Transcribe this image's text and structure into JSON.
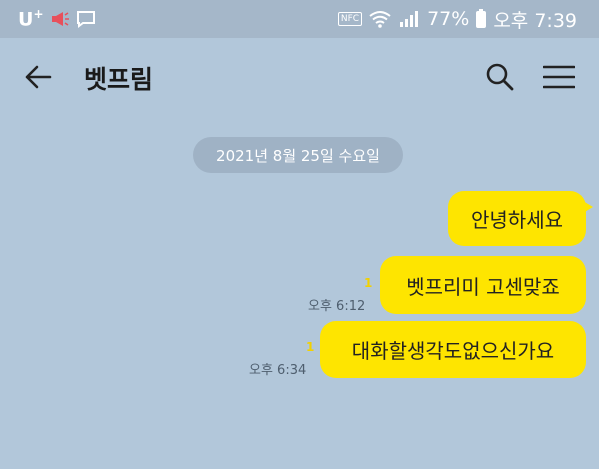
{
  "status_bar": {
    "carrier": "U",
    "carrier_sup": "+",
    "nfc_label": "NFC",
    "battery": "77%",
    "time": "오후 7:39"
  },
  "header": {
    "title": "벳프림",
    "back_icon": "arrow-left-icon",
    "search_icon": "search-icon",
    "menu_icon": "hamburger-menu-icon"
  },
  "date_divider": "2021년 8월 25일 수요일",
  "messages": [
    {
      "text": "안녕하세요",
      "unread": "",
      "time": ""
    },
    {
      "text": "벳프리미 고센맞죠",
      "unread": "1",
      "time": "오후 6:12"
    },
    {
      "text": "대화할생각도없으신가요",
      "unread": "1",
      "time": "오후 6:34"
    }
  ],
  "colors": {
    "background": "#b2c7da",
    "bubble": "#fee500",
    "status_bar": "#a5b7c9",
    "unread": "#f2d100"
  }
}
